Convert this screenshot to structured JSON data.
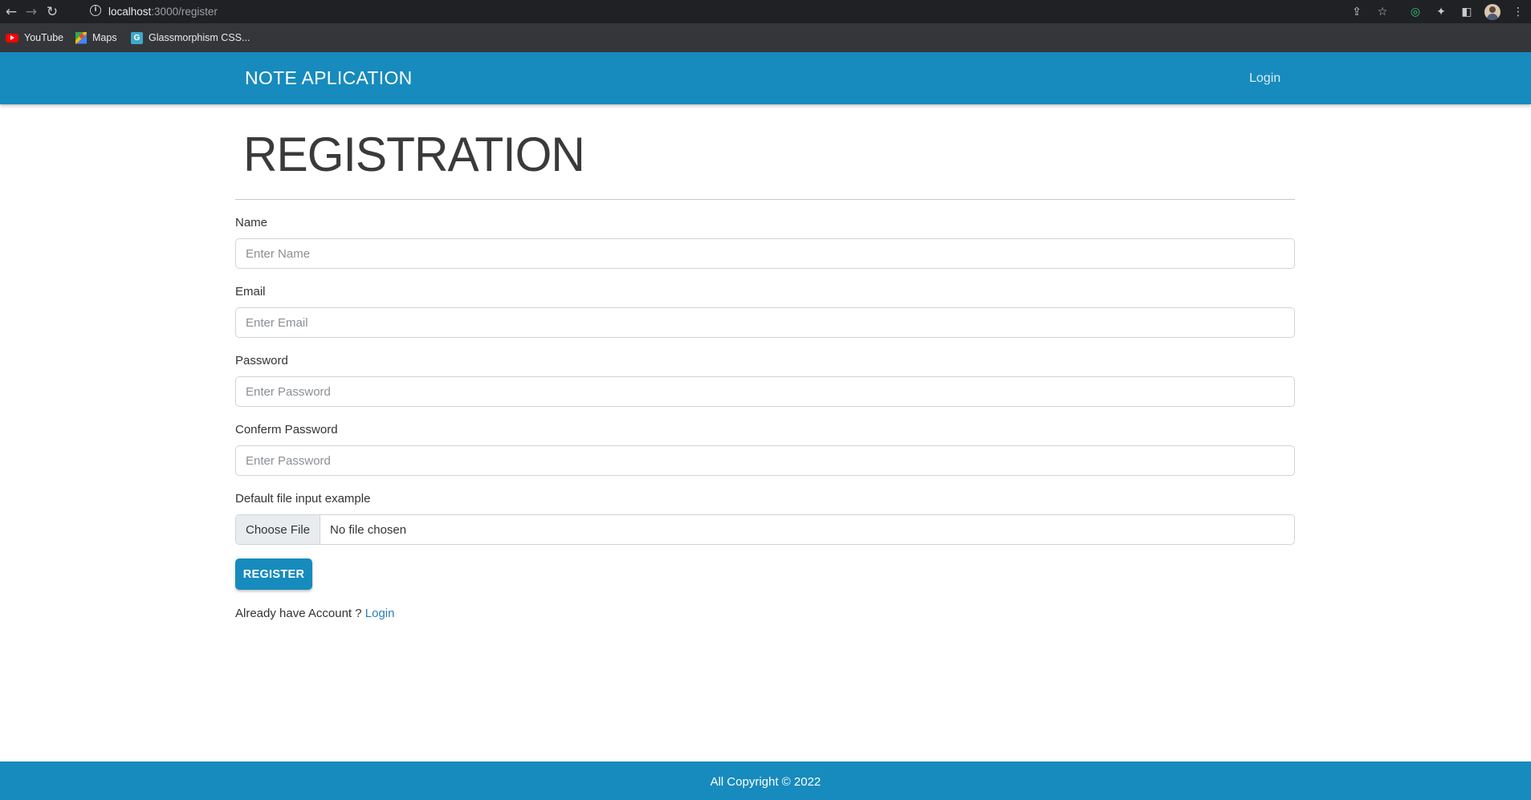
{
  "browser": {
    "url_host": "localhost",
    "url_path": ":3000/register",
    "bookmarks": [
      {
        "label": "YouTube",
        "icon": "youtube-icon"
      },
      {
        "label": "Maps",
        "icon": "maps-icon"
      },
      {
        "label": "Glassmorphism CSS...",
        "icon": "glassmorphism-icon"
      }
    ]
  },
  "navbar": {
    "brand": "NOTE APLICATION",
    "login_link": "Login",
    "color": "#178bbd"
  },
  "main": {
    "title": "REGISTRATION",
    "fields": {
      "name": {
        "label": "Name",
        "placeholder": "Enter Name",
        "value": ""
      },
      "email": {
        "label": "Email",
        "placeholder": "Enter Email",
        "value": ""
      },
      "password": {
        "label": "Password",
        "placeholder": "Enter Password",
        "value": ""
      },
      "confirm_password": {
        "label": "Conferm Password",
        "placeholder": "Enter Password",
        "value": ""
      }
    },
    "file_input": {
      "label": "Default file input example",
      "button_label": "Choose File",
      "status": "No file chosen"
    },
    "register_button": "REGISTER",
    "already_text": "Already have Account ?",
    "already_link": "Login"
  },
  "footer": {
    "text": "All Copyright © 2022"
  }
}
